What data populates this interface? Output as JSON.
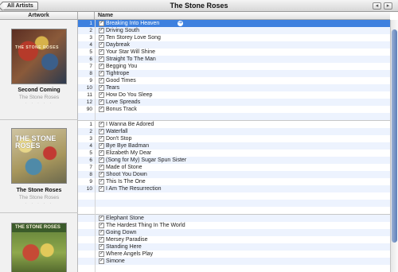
{
  "header": {
    "back_label": "All Artists",
    "title": "The Stone Roses",
    "nav_prev": "◂",
    "nav_next": "▸"
  },
  "columns": {
    "artwork": "Artwork",
    "number": "",
    "name": "Name"
  },
  "albums": [
    {
      "title": "Second Coming",
      "artist": "The Stone Roses",
      "rating": "· · · · ·",
      "cover_text": "THE STONE ROSES",
      "tracks": [
        {
          "n": "1",
          "name": "Breaking Into Heaven",
          "selected": true
        },
        {
          "n": "2",
          "name": "Driving South"
        },
        {
          "n": "3",
          "name": "Ten Storey Love Song"
        },
        {
          "n": "4",
          "name": "Daybreak"
        },
        {
          "n": "5",
          "name": "Your Star Will Shine"
        },
        {
          "n": "6",
          "name": "Straight To The Man"
        },
        {
          "n": "7",
          "name": "Begging You"
        },
        {
          "n": "8",
          "name": "Tightrope"
        },
        {
          "n": "9",
          "name": "Good Times"
        },
        {
          "n": "10",
          "name": "Tears"
        },
        {
          "n": "11",
          "name": "How Do You Sleep"
        },
        {
          "n": "12",
          "name": "Love Spreads"
        },
        {
          "n": "90",
          "name": "Bonus Track"
        }
      ]
    },
    {
      "title": "The Stone Roses",
      "artist": "The Stone Roses",
      "rating": "· · · · ·",
      "cover_text": "THE STONE ROSES",
      "tracks": [
        {
          "n": "1",
          "name": "I Wanna Be Adored"
        },
        {
          "n": "2",
          "name": "Waterfall"
        },
        {
          "n": "3",
          "name": "Don't Stop"
        },
        {
          "n": "4",
          "name": "Bye Bye Badman"
        },
        {
          "n": "5",
          "name": "Elizabeth My Dear"
        },
        {
          "n": "6",
          "name": "(Song for My) Sugar Spun Sister"
        },
        {
          "n": "7",
          "name": "Made of Stone"
        },
        {
          "n": "8",
          "name": "Shoot You Down"
        },
        {
          "n": "9",
          "name": "This Is The One"
        },
        {
          "n": "10",
          "name": "I Am The Resurrection"
        }
      ]
    },
    {
      "title": "",
      "artist": "",
      "rating": "",
      "cover_text": "THE STONE ROSES",
      "tracks": [
        {
          "n": "",
          "name": "Elephant Stone"
        },
        {
          "n": "",
          "name": "The Hardest Thing In The World"
        },
        {
          "n": "",
          "name": "Going Down"
        },
        {
          "n": "",
          "name": "Mersey Paradise"
        },
        {
          "n": "",
          "name": "Standing Here"
        },
        {
          "n": "",
          "name": "Where Angels Play"
        },
        {
          "n": "",
          "name": "Simone"
        }
      ]
    }
  ],
  "check_glyph": "✓",
  "colors": {
    "selection": "#3d80df",
    "alt_row": "#edf3fe"
  }
}
